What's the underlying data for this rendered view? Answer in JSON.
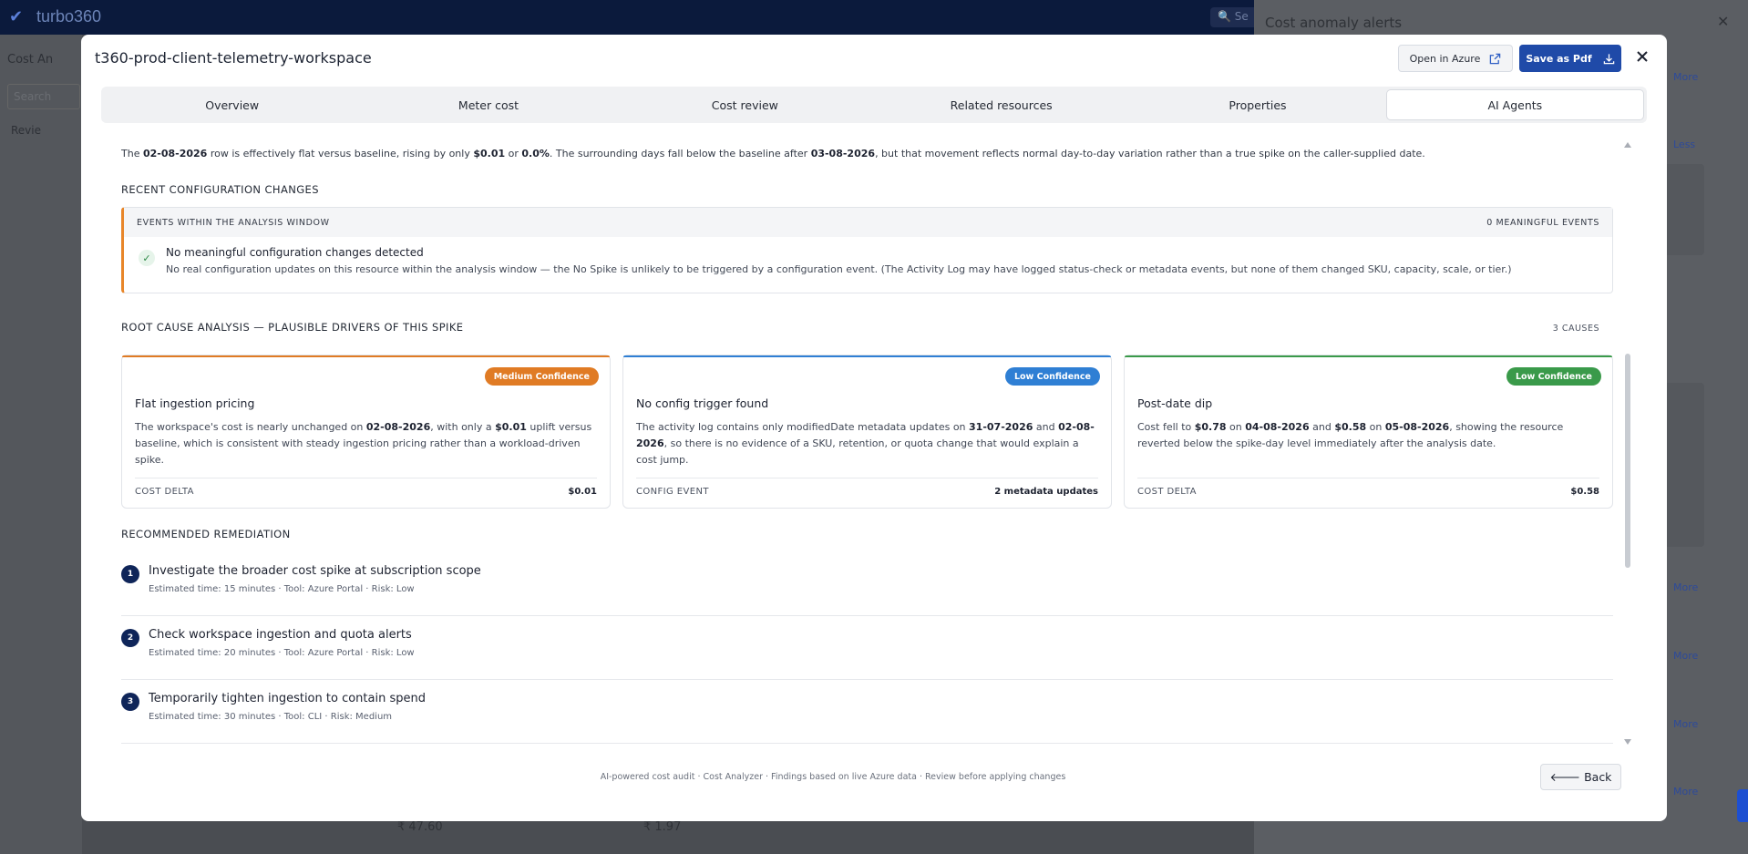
{
  "background": {
    "brand": "turbo360",
    "search_label": "Se",
    "left_title": "Cost An",
    "left_search_placeholder": "Search",
    "left_item": "Revie",
    "side_title": "Cost anomaly alerts",
    "more_label": "More",
    "less_label": "Less",
    "bottom_a": "₹ 47.60",
    "bottom_b": "₹ 1.97"
  },
  "modal": {
    "title": "t360-prod-client-telemetry-workspace",
    "open_azure_label": "Open in Azure",
    "save_pdf_label": "Save as Pdf",
    "tabs": [
      {
        "label": "Overview",
        "active": false
      },
      {
        "label": "Meter cost",
        "active": false
      },
      {
        "label": "Cost review",
        "active": false
      },
      {
        "label": "Related resources",
        "active": false
      },
      {
        "label": "Properties",
        "active": false
      },
      {
        "label": "AI Agents",
        "active": true
      }
    ]
  },
  "intro": {
    "p1": "The ",
    "date1": "02-08-2026",
    "p2": " row is effectively flat versus baseline, rising by only ",
    "amt": "$0.01",
    "p3": " or ",
    "pct": "0.0%",
    "p4": ". The surrounding days fall below the baseline after ",
    "date2": "03-08-2026",
    "p5": ", but that movement reflects normal day-to-day variation rather than a true spike on the caller-supplied date."
  },
  "config": {
    "section_title": "RECENT CONFIGURATION CHANGES",
    "events_header": "EVENTS WITHIN THE ANALYSIS WINDOW",
    "events_count": "0 MEANINGFUL EVENTS",
    "event_title": "No meaningful configuration changes detected",
    "event_desc": "No real configuration updates on this resource within the analysis window — the No Spike is unlikely to be triggered by a configuration event. (The Activity Log may have logged status-check or metadata events, but none of them changed SKU, capacity, scale, or tier.)"
  },
  "rca": {
    "section_title": "ROOT CAUSE ANALYSIS — PLAUSIBLE DRIVERS OF THIS SPIKE",
    "count": "3 CAUSES",
    "causes": [
      {
        "badge": "Medium Confidence",
        "color": "#e07b24",
        "title": "Flat ingestion pricing",
        "d1": "The workspace's cost is nearly unchanged on ",
        "b1": "02-08-2026",
        "d2": ", with only a ",
        "b2": "$0.01",
        "d3": " uplift versus baseline, which is consistent with steady ingestion pricing rather than a workload-driven spike.",
        "b3": "",
        "d4": "",
        "b4": "",
        "d5": "",
        "foot_label": "COST DELTA",
        "foot_value": "$0.01"
      },
      {
        "badge": "Low Confidence",
        "color": "#2f7fd4",
        "title": "No config trigger found",
        "d1": "The activity log contains only modifiedDate metadata updates on ",
        "b1": "31-07-2026",
        "d2": " and ",
        "b2": "02-08-2026",
        "d3": ", so there is no evidence of a SKU, retention, or quota change that would explain a cost jump.",
        "b3": "",
        "d4": "",
        "b4": "",
        "d5": "",
        "foot_label": "CONFIG EVENT",
        "foot_value": "2 metadata updates"
      },
      {
        "badge": "Low Confidence",
        "color": "#3a9a4a",
        "title": "Post-date dip",
        "d1": "Cost fell to ",
        "b1": "$0.78",
        "d2": " on ",
        "b2": "04-08-2026",
        "d3": " and ",
        "b3": "$0.58",
        "d4": " on ",
        "b4": "05-08-2026",
        "d5": ", showing the resource reverted below the spike-day level immediately after the analysis date.",
        "foot_label": "COST DELTA",
        "foot_value": "$0.58"
      }
    ]
  },
  "remediation": {
    "section_title": "RECOMMENDED REMEDIATION",
    "items": [
      {
        "num": "1",
        "title": "Investigate the broader cost spike at subscription scope",
        "meta": "Estimated time: 15 minutes · Tool: Azure Portal · Risk: Low"
      },
      {
        "num": "2",
        "title": "Check workspace ingestion and quota alerts",
        "meta": "Estimated time: 20 minutes · Tool: Azure Portal · Risk: Low"
      },
      {
        "num": "3",
        "title": "Temporarily tighten ingestion to contain spend",
        "meta": "Estimated time: 30 minutes · Tool: CLI · Risk: Medium"
      }
    ]
  },
  "footer": {
    "note": "AI-powered cost audit · Cost Analyzer · Findings based on live Azure data · Review before applying changes",
    "back_label": "Back"
  }
}
